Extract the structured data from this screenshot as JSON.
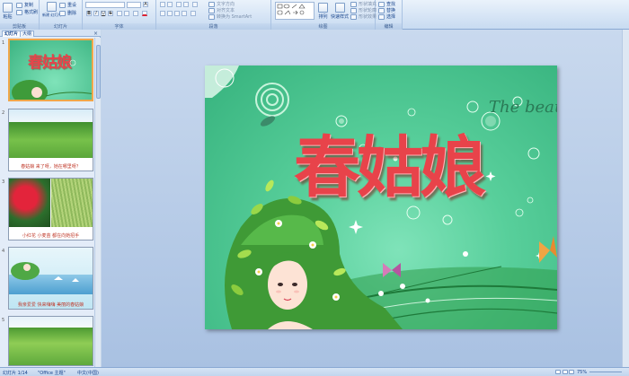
{
  "ribbon": {
    "clipboard": {
      "paste_label": "粘贴",
      "copy_label": "复制",
      "format_label": "格式刷",
      "group": "剪贴板"
    },
    "slides": {
      "new_label": "新建\n幻灯片",
      "reset_label": "重设",
      "delete_label": "删除",
      "group": "幻灯片"
    },
    "font": {
      "group": "字体",
      "bold": "B",
      "italic": "I",
      "underline": "U",
      "strike": "S"
    },
    "paragraph": {
      "group": "段落",
      "text_direction": "文字方向",
      "align_text": "对齐文本",
      "smartart": "转换为 SmartArt"
    },
    "drawing": {
      "group": "绘图",
      "arrange": "排列",
      "quick_styles": "快速样式",
      "fill": "形状填充",
      "outline": "形状轮廓",
      "effects": "形状效果"
    },
    "editing": {
      "group": "编辑",
      "find": "查找",
      "replace": "替换",
      "select": "选择"
    }
  },
  "panel": {
    "tab_slides": "幻灯片",
    "tab_outline": "大纲",
    "close": "×",
    "thumbs": [
      {
        "num": "1",
        "title": "春姑娘",
        "caption": ""
      },
      {
        "num": "2",
        "title": "",
        "caption": "春姑娘 来了呀，她在哪里呀？"
      },
      {
        "num": "3",
        "title": "",
        "caption": "小红花 小麦苗 都在向她招手"
      },
      {
        "num": "4",
        "title": "",
        "caption": "我亲爱爱 快来嗨嗨 美丽的春姑娘"
      },
      {
        "num": "5",
        "title": "",
        "caption": ""
      }
    ]
  },
  "slide": {
    "title": "春姑娘",
    "subtitle": "The beauty"
  },
  "status": {
    "slide_info": "幻灯片 1/14",
    "theme": "\"Office 主题\"",
    "language": "中文(中国)",
    "zoom": "75%"
  }
}
